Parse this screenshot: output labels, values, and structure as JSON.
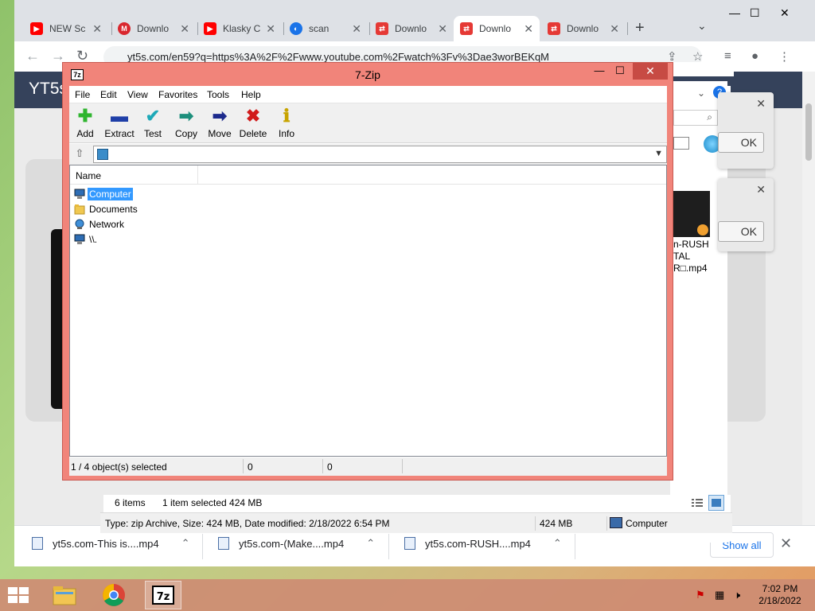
{
  "browser": {
    "tabs": [
      {
        "label": "NEW Sc",
        "favicon": "youtube",
        "color": "#ff0000"
      },
      {
        "label": "Downlo",
        "favicon": "mega",
        "color": "#d9272e"
      },
      {
        "label": "Klasky C",
        "favicon": "youtube",
        "color": "#ff0000"
      },
      {
        "label": "scan",
        "favicon": "scan",
        "color": "#1a73e8"
      },
      {
        "label": "Downlo",
        "favicon": "yt5s",
        "color": "#e53935"
      },
      {
        "label": "Downlo",
        "favicon": "yt5s",
        "color": "#e53935"
      },
      {
        "label": "Downlo",
        "favicon": "yt5s",
        "color": "#e53935"
      }
    ],
    "active_tab_index": 5,
    "new_tab_symbol": "+",
    "tab_menu_symbol": "⌄",
    "window_controls": {
      "minimize": "—",
      "maximize": "☐",
      "close": "✕"
    },
    "url": "yt5s.com/en59?q=https%3A%2F%2Fwww.youtube.com%2Fwatch%3Fv%3Dae3worBEKqM",
    "page_logo": "YT5s",
    "downloads": [
      {
        "name": "yt5s.com-This is....mp4"
      },
      {
        "name": "yt5s.com-(Make....mp4"
      },
      {
        "name": "yt5s.com-RUSH....mp4"
      }
    ],
    "show_all_label": "Show all",
    "close_downloads_symbol": "✕"
  },
  "explorer_bg": {
    "msgbox_ok_1": "OK",
    "msgbox_ok_2": "OK",
    "thumbnail_caption": [
      "n-RUSH",
      "TAL",
      "R□.mp4"
    ],
    "item_count": "6 items",
    "selection_info": "1 item selected  424 MB",
    "detail_text": "Type: zip Archive, Size: 424 MB, Date modified: 2/18/2022 6:54 PM",
    "detail_size": "424 MB",
    "detail_location": "Computer"
  },
  "sevenzip": {
    "title": "7-Zip",
    "app_icon_text": "7z",
    "title_buttons": {
      "minimize": "—",
      "maximize": "☐",
      "close": "✕"
    },
    "menu": [
      "File",
      "Edit",
      "View",
      "Favorites",
      "Tools",
      "Help"
    ],
    "toolbar": [
      {
        "label": "Add",
        "icon": "add-icon",
        "glyph": "✚",
        "color": "#2fb52f"
      },
      {
        "label": "Extract",
        "icon": "extract-icon",
        "glyph": "▬",
        "color": "#1f3fa8"
      },
      {
        "label": "Test",
        "icon": "test-icon",
        "glyph": "✔",
        "color": "#1ea9b8"
      },
      {
        "label": "Copy",
        "icon": "copy-icon",
        "glyph": "➡",
        "color": "#1d8f7c"
      },
      {
        "label": "Move",
        "icon": "move-icon",
        "glyph": "➡",
        "color": "#1c2a8c"
      },
      {
        "label": "Delete",
        "icon": "delete-icon",
        "glyph": "✖",
        "color": "#d11b1b"
      },
      {
        "label": "Info",
        "icon": "info-icon",
        "glyph": "ℹ",
        "color": "#c8a400"
      }
    ],
    "column_name": "Name",
    "items": [
      {
        "name": "Computer",
        "icon": "computer-icon",
        "selected": true
      },
      {
        "name": "Documents",
        "icon": "folder-icon",
        "selected": false
      },
      {
        "name": "Network",
        "icon": "network-icon",
        "selected": false
      },
      {
        "name": "\\\\.",
        "icon": "computer-icon",
        "selected": false
      }
    ],
    "status": {
      "selection": "1 / 4 object(s) selected",
      "size": "0",
      "packed": "0"
    }
  },
  "taskbar": {
    "clock_time": "7:02 PM",
    "clock_date": "2/18/2022",
    "apps": [
      "file-explorer",
      "chrome",
      "7-zip"
    ]
  }
}
